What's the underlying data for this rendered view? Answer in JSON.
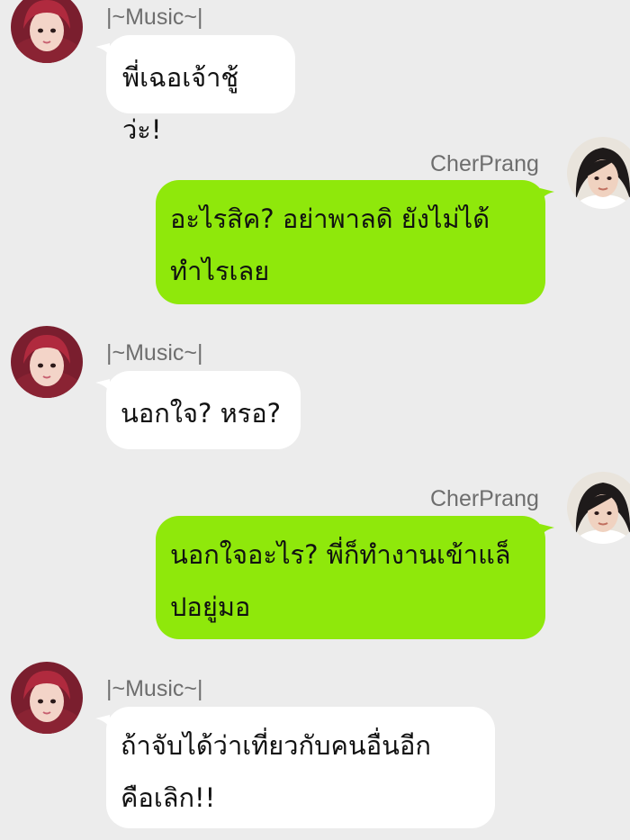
{
  "messages": [
    {
      "side": "in",
      "sender": "|~Music~|",
      "lines": [
        "พี่เฉอเจ้าชู้ว่ะ!"
      ]
    },
    {
      "side": "out",
      "sender": "CherPrang",
      "lines": [
        "อะไรสิค? อย่าพาลดิ ยังไม่ได้",
        "ทำไรเลย"
      ]
    },
    {
      "side": "in",
      "sender": "|~Music~|",
      "lines": [
        "นอกใจ? หรอ?"
      ]
    },
    {
      "side": "out",
      "sender": "CherPrang",
      "lines": [
        "นอกใจอะไร? พี่ก็ทำงานเข้าแล็",
        "ปอยู่มอ"
      ]
    },
    {
      "side": "in",
      "sender": "|~Music~|",
      "lines": [
        "ถ้าจับได้ว่าเที่ยวกับคนอื่นอีก",
        "คือเลิก!!"
      ]
    }
  ],
  "colors": {
    "background": "#ececec",
    "incoming_bubble": "#ffffff",
    "outgoing_bubble": "#8fe80b",
    "sender_name": "#6e6e6e"
  }
}
